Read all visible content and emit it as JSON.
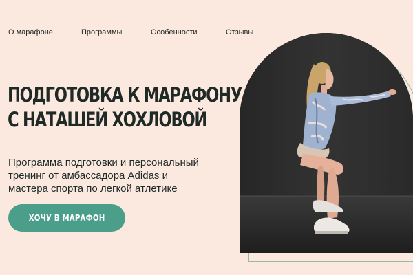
{
  "nav": {
    "items": [
      {
        "label": "О марафоне"
      },
      {
        "label": "Программы"
      },
      {
        "label": "Особенности"
      },
      {
        "label": "Отзывы"
      }
    ]
  },
  "hero": {
    "title_lines": [
      "ПОДГОТОВКА К МАРАФОНУ",
      "С НАТАШЕЙ ХОХЛОВОЙ"
    ],
    "description_lines": [
      "Программа подготовки и персональный",
      "тренинг от амбассадора Adidas и",
      "мастера спорта по легкой атлетике"
    ],
    "cta_label": "ХОЧУ В МАРАФОН"
  },
  "colors": {
    "background": "#fbe9df",
    "accent": "#4a9e8a",
    "text": "#1f2a27"
  }
}
